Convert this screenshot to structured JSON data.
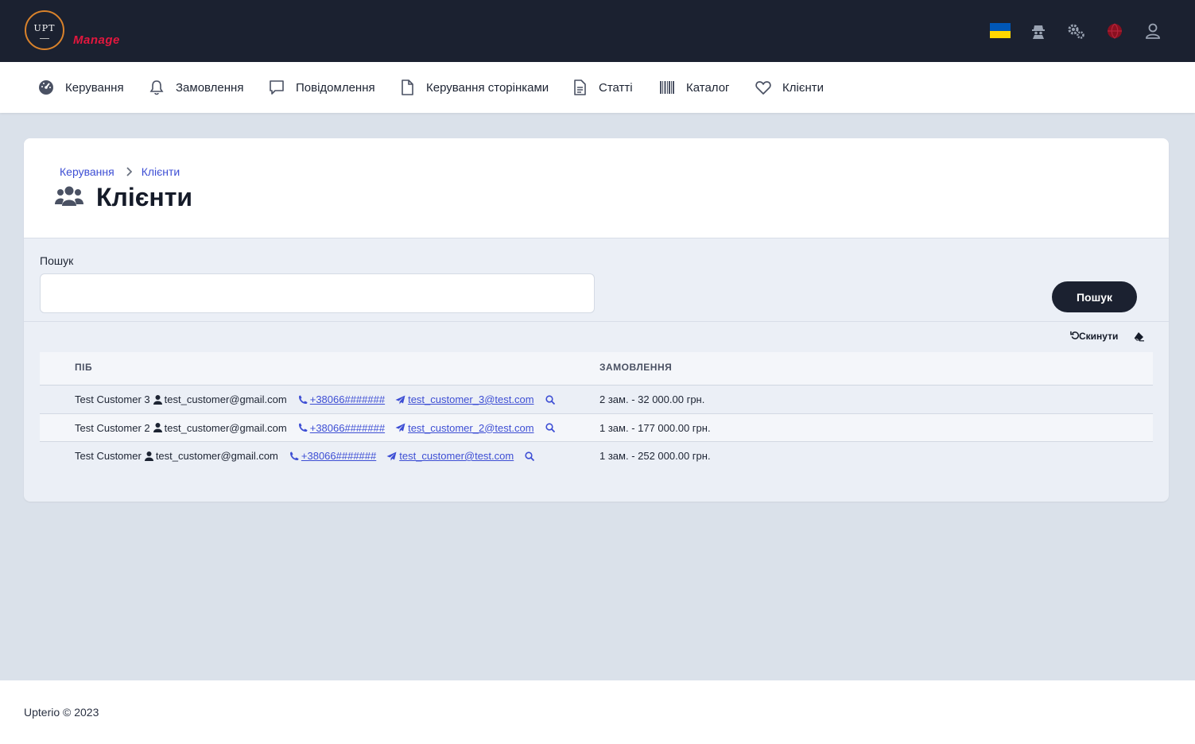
{
  "brand": {
    "logo_text": "UPT",
    "manage_label": "Manage"
  },
  "colors": {
    "header_bg": "#1b2130",
    "accent_link": "#3d4ed4",
    "manage_red": "#e3173e",
    "page_bg": "#dae1ea"
  },
  "header_icons": [
    "ukraine-flag",
    "spy-icon",
    "gears-icon",
    "globe-icon",
    "user-icon"
  ],
  "nav": {
    "items": [
      {
        "label": "Керування",
        "icon": "dashboard-icon"
      },
      {
        "label": "Замовлення",
        "icon": "bell-icon"
      },
      {
        "label": "Повідомлення",
        "icon": "message-icon"
      },
      {
        "label": "Керування сторінками",
        "icon": "file-icon"
      },
      {
        "label": "Статті",
        "icon": "file-text-icon"
      },
      {
        "label": "Каталог",
        "icon": "barcode-icon"
      },
      {
        "label": "Клієнти",
        "icon": "heart-icon"
      }
    ]
  },
  "breadcrumb": {
    "items": [
      "Керування",
      "Клієнти"
    ]
  },
  "page": {
    "title": "Клієнти"
  },
  "search": {
    "label": "Пошук",
    "value": "",
    "button_label": "Пошук"
  },
  "toolbar": {
    "reset_label": "Скинути"
  },
  "table": {
    "headers": [
      "ПІБ",
      "ЗАМОВЛЕННЯ"
    ],
    "rows": [
      {
        "name": "Test Customer 3",
        "username": "test_customer@gmail.com",
        "phone": "+38066#######",
        "email": "test_customer_3@test.com",
        "orders": "2 зам. - 32 000.00 грн."
      },
      {
        "name": "Test Customer 2",
        "username": "test_customer@gmail.com",
        "phone": "+38066#######",
        "email": "test_customer_2@test.com",
        "orders": "1 зам. - 177 000.00 грн."
      },
      {
        "name": "Test Customer",
        "username": "test_customer@gmail.com",
        "phone": "+38066#######",
        "email": "test_customer@test.com",
        "orders": "1 зам. - 252 000.00 грн."
      }
    ]
  },
  "footer": {
    "text": "Upterio © 2023"
  }
}
